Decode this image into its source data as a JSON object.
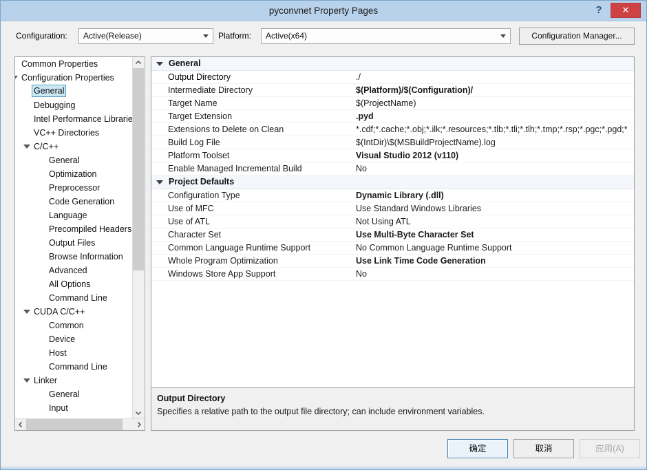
{
  "window": {
    "title": "pyconvnet Property Pages",
    "help_label": "?",
    "close_label": "✕"
  },
  "config_bar": {
    "configuration_label": "Configuration:",
    "configuration_value": "Active(Release)",
    "platform_label": "Platform:",
    "platform_value": "Active(x64)",
    "configuration_manager_label": "Configuration Manager..."
  },
  "tree": {
    "items": [
      {
        "label": "Common Properties",
        "indent": 0,
        "expander": "collapsed",
        "selected": false
      },
      {
        "label": "Configuration Properties",
        "indent": 0,
        "expander": "expanded",
        "selected": false
      },
      {
        "label": "General",
        "indent": 1,
        "expander": "none",
        "selected": true
      },
      {
        "label": "Debugging",
        "indent": 1,
        "expander": "none",
        "selected": false
      },
      {
        "label": "Intel Performance Libraries",
        "indent": 1,
        "expander": "none",
        "selected": false
      },
      {
        "label": "VC++ Directories",
        "indent": 1,
        "expander": "none",
        "selected": false
      },
      {
        "label": "C/C++",
        "indent": 1,
        "expander": "expanded",
        "selected": false
      },
      {
        "label": "General",
        "indent": 2,
        "expander": "none",
        "selected": false
      },
      {
        "label": "Optimization",
        "indent": 2,
        "expander": "none",
        "selected": false
      },
      {
        "label": "Preprocessor",
        "indent": 2,
        "expander": "none",
        "selected": false
      },
      {
        "label": "Code Generation",
        "indent": 2,
        "expander": "none",
        "selected": false
      },
      {
        "label": "Language",
        "indent": 2,
        "expander": "none",
        "selected": false
      },
      {
        "label": "Precompiled Headers",
        "indent": 2,
        "expander": "none",
        "selected": false
      },
      {
        "label": "Output Files",
        "indent": 2,
        "expander": "none",
        "selected": false
      },
      {
        "label": "Browse Information",
        "indent": 2,
        "expander": "none",
        "selected": false
      },
      {
        "label": "Advanced",
        "indent": 2,
        "expander": "none",
        "selected": false
      },
      {
        "label": "All Options",
        "indent": 2,
        "expander": "none",
        "selected": false
      },
      {
        "label": "Command Line",
        "indent": 2,
        "expander": "none",
        "selected": false
      },
      {
        "label": "CUDA C/C++",
        "indent": 1,
        "expander": "expanded",
        "selected": false
      },
      {
        "label": "Common",
        "indent": 2,
        "expander": "none",
        "selected": false
      },
      {
        "label": "Device",
        "indent": 2,
        "expander": "none",
        "selected": false
      },
      {
        "label": "Host",
        "indent": 2,
        "expander": "none",
        "selected": false
      },
      {
        "label": "Command Line",
        "indent": 2,
        "expander": "none",
        "selected": false
      },
      {
        "label": "Linker",
        "indent": 1,
        "expander": "expanded",
        "selected": false
      },
      {
        "label": "General",
        "indent": 2,
        "expander": "none",
        "selected": false
      },
      {
        "label": "Input",
        "indent": 2,
        "expander": "none",
        "selected": false
      }
    ]
  },
  "grid": {
    "rows": [
      {
        "kind": "category",
        "name": "General"
      },
      {
        "kind": "prop",
        "name": "Output Directory",
        "value": "./",
        "bold": false,
        "selected": true
      },
      {
        "kind": "prop",
        "name": "Intermediate Directory",
        "value": "$(Platform)/$(Configuration)/",
        "bold": true
      },
      {
        "kind": "prop",
        "name": "Target Name",
        "value": "$(ProjectName)",
        "bold": false
      },
      {
        "kind": "prop",
        "name": "Target Extension",
        "value": ".pyd",
        "bold": true
      },
      {
        "kind": "prop",
        "name": "Extensions to Delete on Clean",
        "value": "*.cdf;*.cache;*.obj;*.ilk;*.resources;*.tlb;*.tli;*.tlh;*.tmp;*.rsp;*.pgc;*.pgd;*",
        "bold": false
      },
      {
        "kind": "prop",
        "name": "Build Log File",
        "value": "$(IntDir)\\$(MSBuildProjectName).log",
        "bold": false
      },
      {
        "kind": "prop",
        "name": "Platform Toolset",
        "value": "Visual Studio 2012 (v110)",
        "bold": true
      },
      {
        "kind": "prop",
        "name": "Enable Managed Incremental Build",
        "value": "No",
        "bold": false
      },
      {
        "kind": "category",
        "name": "Project Defaults"
      },
      {
        "kind": "prop",
        "name": "Configuration Type",
        "value": "Dynamic Library (.dll)",
        "bold": true
      },
      {
        "kind": "prop",
        "name": "Use of MFC",
        "value": "Use Standard Windows Libraries",
        "bold": false
      },
      {
        "kind": "prop",
        "name": "Use of ATL",
        "value": "Not Using ATL",
        "bold": false
      },
      {
        "kind": "prop",
        "name": "Character Set",
        "value": "Use Multi-Byte Character Set",
        "bold": true
      },
      {
        "kind": "prop",
        "name": "Common Language Runtime Support",
        "value": "No Common Language Runtime Support",
        "bold": false
      },
      {
        "kind": "prop",
        "name": "Whole Program Optimization",
        "value": "Use Link Time Code Generation",
        "bold": true
      },
      {
        "kind": "prop",
        "name": "Windows Store App Support",
        "value": "No",
        "bold": false
      }
    ]
  },
  "description": {
    "title": "Output Directory",
    "body": "Specifies a relative path to the output file directory; can include environment variables."
  },
  "footer": {
    "ok_label": "确定",
    "cancel_label": "取消",
    "apply_label": "应用(A)"
  }
}
